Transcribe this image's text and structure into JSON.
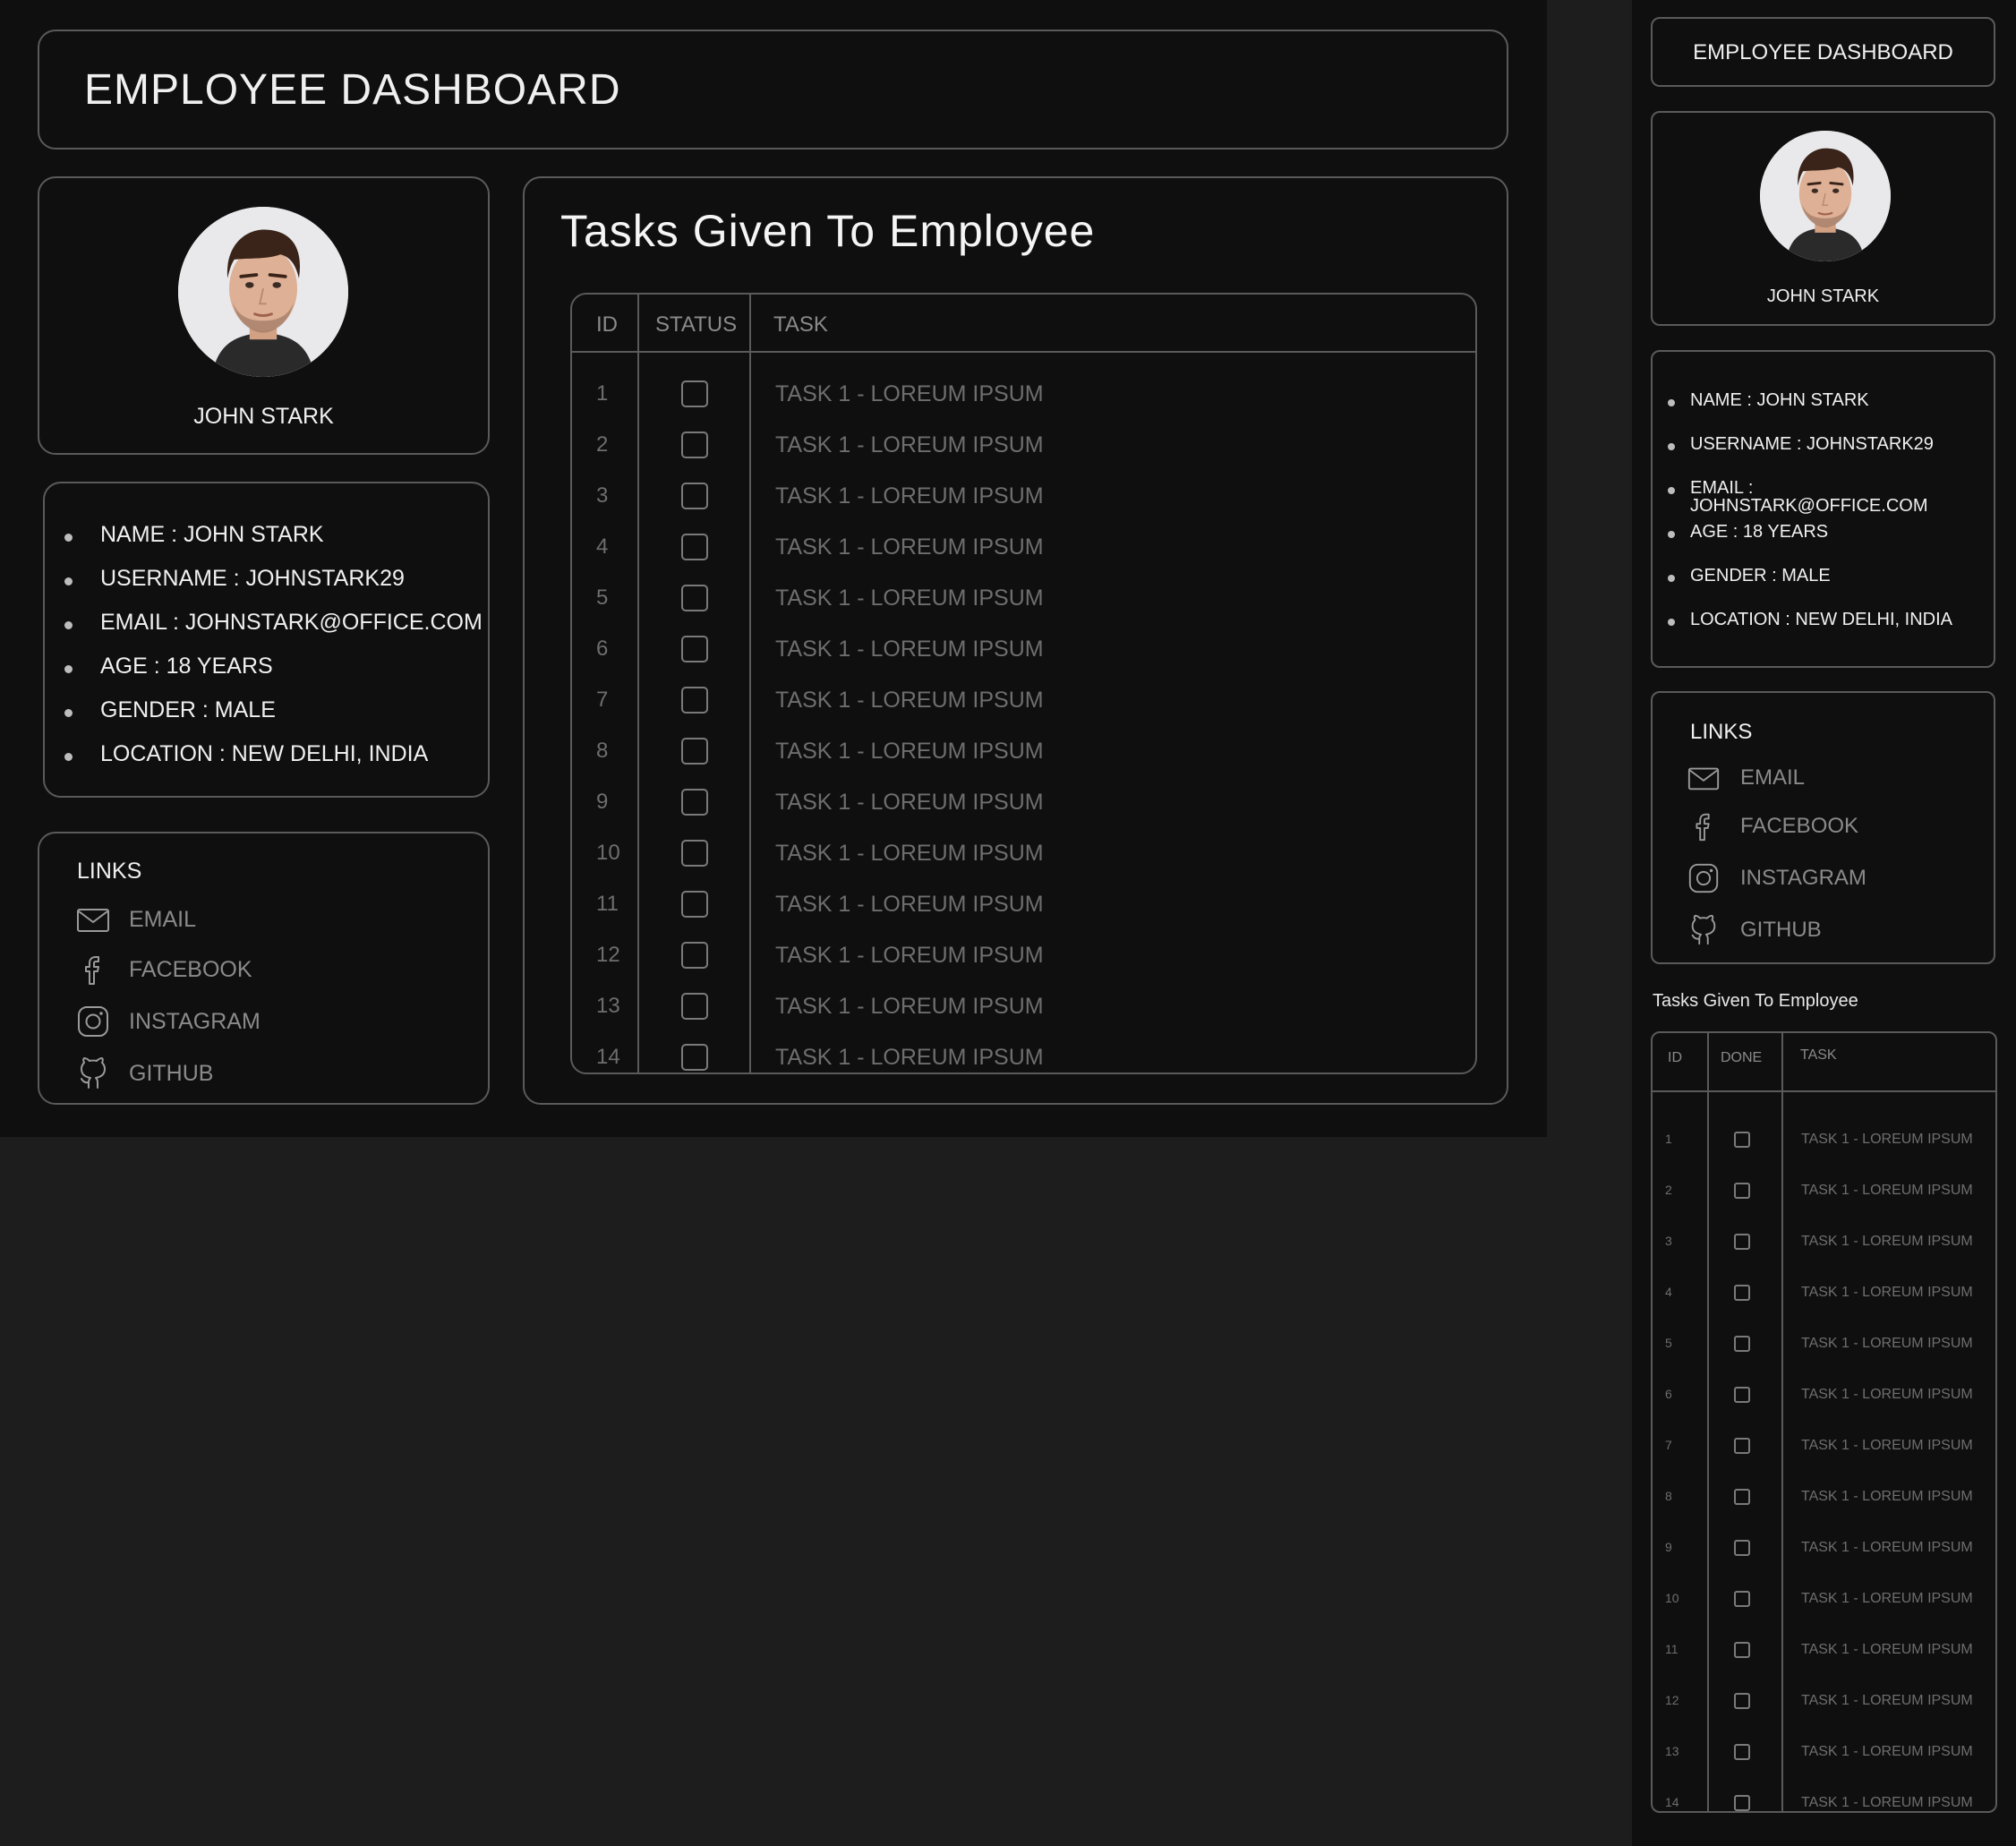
{
  "app": {
    "title": "EMPLOYEE DASHBOARD"
  },
  "profile": {
    "name": "JOHN STARK",
    "avatar_icon": "person-portrait"
  },
  "details": [
    {
      "label": "NAME : JOHN STARK"
    },
    {
      "label": "USERNAME : JOHNSTARK29"
    },
    {
      "label": "EMAIL : JOHNSTARK@OFFICE.COM"
    },
    {
      "label": "AGE : 18 YEARS"
    },
    {
      "label": "GENDER : MALE"
    },
    {
      "label": "LOCATION : NEW DELHI, INDIA"
    }
  ],
  "links": {
    "title": "LINKS",
    "items": [
      {
        "label": "EMAIL",
        "icon": "mail-icon"
      },
      {
        "label": "FACEBOOK",
        "icon": "facebook-icon"
      },
      {
        "label": "INSTAGRAM",
        "icon": "instagram-icon"
      },
      {
        "label": "GITHUB",
        "icon": "github-icon"
      }
    ]
  },
  "tasks": {
    "title": "Tasks Given To Employee",
    "columns_desktop": [
      "ID",
      "STATUS",
      "TASK"
    ],
    "columns_mobile": [
      "ID",
      "DONE",
      "TASK"
    ],
    "rows": [
      {
        "id": "1",
        "task": "TASK 1 - LOREUM IPSUM",
        "done": false
      },
      {
        "id": "2",
        "task": "TASK 1 - LOREUM IPSUM",
        "done": false
      },
      {
        "id": "3",
        "task": "TASK 1 - LOREUM IPSUM",
        "done": false
      },
      {
        "id": "4",
        "task": "TASK 1 - LOREUM IPSUM",
        "done": false
      },
      {
        "id": "5",
        "task": "TASK 1 - LOREUM IPSUM",
        "done": false
      },
      {
        "id": "6",
        "task": "TASK 1 - LOREUM IPSUM",
        "done": false
      },
      {
        "id": "7",
        "task": "TASK 1 - LOREUM IPSUM",
        "done": false
      },
      {
        "id": "8",
        "task": "TASK 1 - LOREUM IPSUM",
        "done": false
      },
      {
        "id": "9",
        "task": "TASK 1 - LOREUM IPSUM",
        "done": false
      },
      {
        "id": "10",
        "task": "TASK 1 - LOREUM IPSUM",
        "done": false
      },
      {
        "id": "11",
        "task": "TASK 1 - LOREUM IPSUM",
        "done": false
      },
      {
        "id": "12",
        "task": "TASK 1 - LOREUM IPSUM",
        "done": false
      },
      {
        "id": "13",
        "task": "TASK 1 - LOREUM IPSUM",
        "done": false
      },
      {
        "id": "14",
        "task": "TASK 1 - LOREUM IPSUM",
        "done": false
      }
    ]
  },
  "colors": {
    "background": "#1d1d1d",
    "panel": "#0f0f0f",
    "border": "#5a5a5a",
    "text": "#f0f0f0",
    "muted": "#8a8a8a"
  }
}
